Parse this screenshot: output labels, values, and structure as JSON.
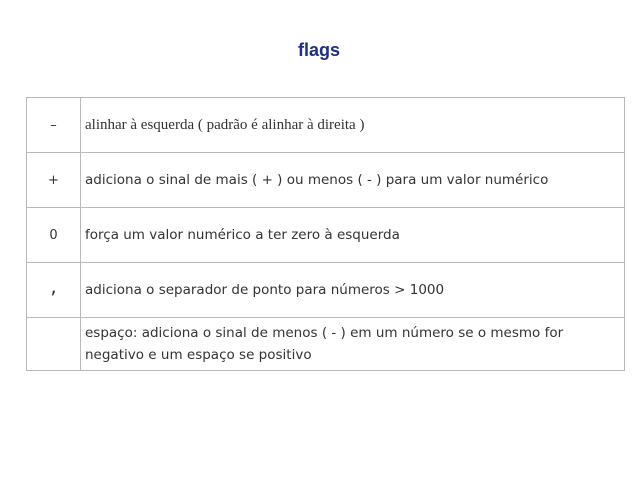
{
  "title": "flags",
  "rows": [
    {
      "flag": "–",
      "description": "alinhar à esquerda ( padrão é alinhar à direita )"
    },
    {
      "flag": "+",
      "description": "adiciona o sinal de mais ( + ) ou menos ( - ) para um valor numérico"
    },
    {
      "flag": "0",
      "description": "força um valor numérico a ter zero à esquerda"
    },
    {
      "flag": ",",
      "description": "adiciona o separador de ponto para números > 1000"
    },
    {
      "flag": "",
      "description": "espaço: adiciona o sinal de menos ( - ) em um número se o mesmo for negativo e um espaço se positivo"
    }
  ]
}
